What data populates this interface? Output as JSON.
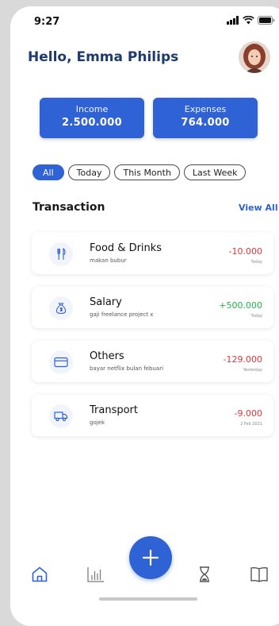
{
  "status": {
    "time": "9:27"
  },
  "header": {
    "greeting": "Hello, Emma Philips"
  },
  "summary": {
    "income_label": "Income",
    "income_value": "2.500.000",
    "expenses_label": "Expenses",
    "expenses_value": "764.000"
  },
  "filters": [
    {
      "label": "All",
      "active": true
    },
    {
      "label": "Today",
      "active": false
    },
    {
      "label": "This Month",
      "active": false
    },
    {
      "label": "Last Week",
      "active": false
    }
  ],
  "transactions": {
    "title": "Transaction",
    "view_all": "View All",
    "items": [
      {
        "icon": "fork-knife-icon",
        "title": "Food & Drinks",
        "note": "makan bubur",
        "amount": "-10.000",
        "date": "Today",
        "direction": "out"
      },
      {
        "icon": "money-bag-icon",
        "title": "Salary",
        "note": "gaji freelance project x",
        "amount": "+500.000",
        "date": "Today",
        "direction": "in"
      },
      {
        "icon": "credit-card-icon",
        "title": "Others",
        "note": "bayar netflix bulan febuari",
        "amount": "-129.000",
        "date": "Yesterday",
        "direction": "out"
      },
      {
        "icon": "truck-icon",
        "title": "Transport",
        "note": "gojek",
        "amount": "-9.000",
        "date": "2 Feb 2021",
        "direction": "out"
      }
    ]
  },
  "colors": {
    "primary": "#2f62d4",
    "title": "#1e3a6f",
    "negative": "#e03535",
    "positive": "#22b14c"
  },
  "nav": [
    "home-icon",
    "chart-icon",
    "add-icon",
    "hourglass-icon",
    "book-icon"
  ]
}
